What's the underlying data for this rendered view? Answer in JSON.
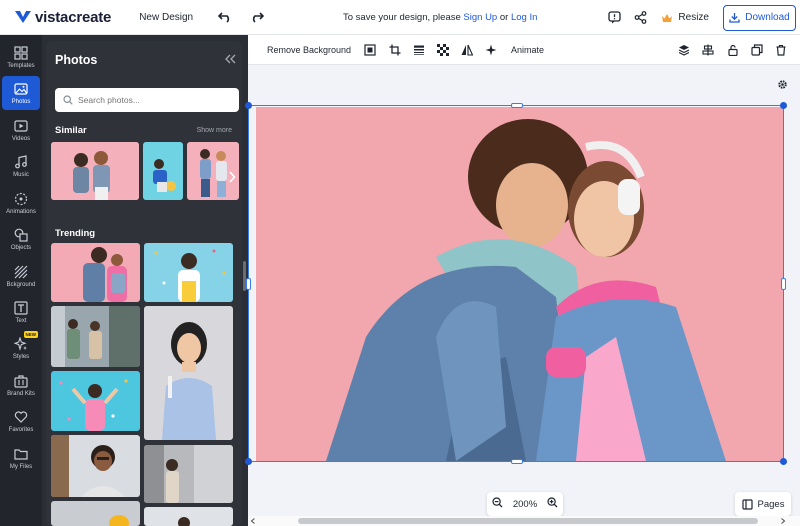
{
  "header": {
    "logo_text": "vistacreate",
    "new_design": "New Design",
    "save_prefix": "To save your design, please",
    "sign_up": "Sign Up",
    "or": "or",
    "log_in": "Log In",
    "resize": "Resize",
    "download": "Download"
  },
  "rail": {
    "items": [
      {
        "label": "Templates",
        "icon": "templates-icon"
      },
      {
        "label": "Photos",
        "icon": "photos-icon",
        "active": true
      },
      {
        "label": "Videos",
        "icon": "videos-icon"
      },
      {
        "label": "Music",
        "icon": "music-icon"
      },
      {
        "label": "Animations",
        "icon": "animations-icon"
      },
      {
        "label": "Objects",
        "icon": "objects-icon"
      },
      {
        "label": "Bckground",
        "icon": "background-icon"
      },
      {
        "label": "Text",
        "icon": "text-icon"
      },
      {
        "label": "Styles",
        "icon": "styles-icon",
        "badge": "NEW"
      },
      {
        "label": "Brand Kits",
        "icon": "brand-kits-icon"
      },
      {
        "label": "Favorites",
        "icon": "heart-icon"
      },
      {
        "label": "My Files",
        "icon": "folder-icon"
      }
    ]
  },
  "panel": {
    "title": "Photos",
    "search_placeholder": "Search photos...",
    "similar_title": "Similar",
    "show_more": "Show more",
    "trending_title": "Trending"
  },
  "toolbar": {
    "remove_background": "Remove Background",
    "animate": "Animate"
  },
  "canvas": {
    "zoom": "200%",
    "pages": "Pages"
  },
  "colors": {
    "accent": "#1e5ad6",
    "canvas_pink": "#f2a6ad",
    "rail_bg": "#23252c",
    "panel_bg": "#30323a"
  }
}
